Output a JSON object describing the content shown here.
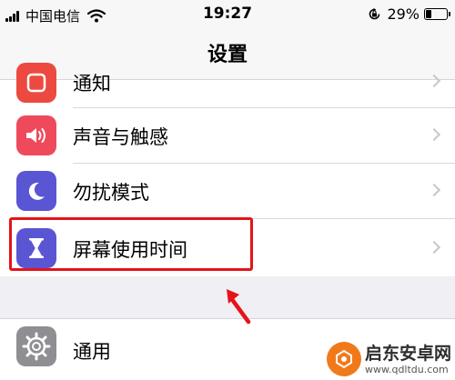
{
  "status_bar": {
    "carrier": "中国电信",
    "time": "19:27",
    "battery_percent": "29%",
    "battery_level": 0.29
  },
  "nav": {
    "title": "设置"
  },
  "settings_rows": [
    {
      "label": "通知",
      "icon": "notifications-icon",
      "icon_color": "#ec4a40"
    },
    {
      "label": "声音与触感",
      "icon": "speaker-icon",
      "icon_color": "#ee4a5c"
    },
    {
      "label": "勿扰模式",
      "icon": "moon-icon",
      "icon_color": "#5a55d2"
    },
    {
      "label": "屏幕使用时间",
      "icon": "hourglass-icon",
      "icon_color": "#5a55d2"
    }
  ],
  "general_row": {
    "label": "通用",
    "icon": "gear-icon",
    "icon_color": "#8e8e93"
  },
  "watermark": {
    "title": "启东安卓网",
    "url": "www.qdltdu.com"
  },
  "colors": {
    "highlight": "#e4141a",
    "background": "#efeff4"
  }
}
